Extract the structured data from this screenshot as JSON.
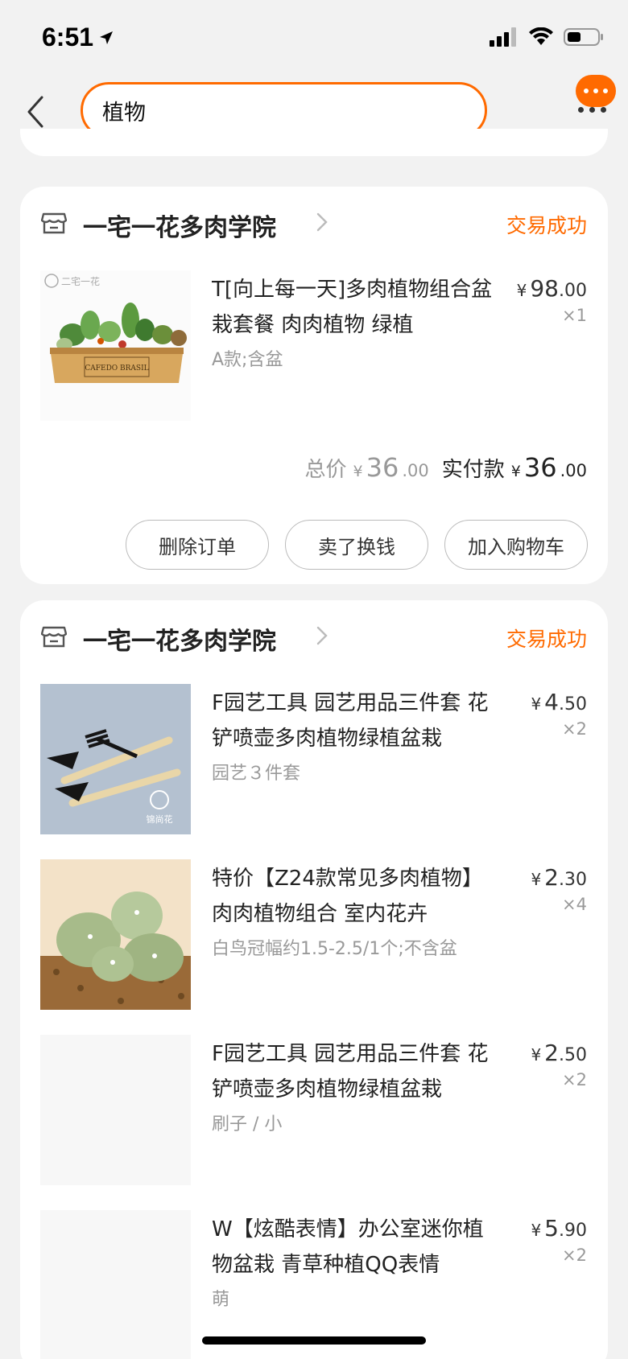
{
  "status_bar": {
    "time": "6:51"
  },
  "header": {
    "search_value": "植物"
  },
  "orders": [
    {
      "shop_name": "一宅一花多肉学院",
      "status": "交易成功",
      "items": [
        {
          "title": "T[向上每一天]多肉植物组合盆栽套餐 肉肉植物 绿植",
          "sku": "A款;含盆",
          "price_int": "98",
          "price_dec": ".00",
          "currency": "¥",
          "qty": "×1"
        }
      ],
      "total_label": "总价",
      "total_int": "36",
      "total_dec": ".00",
      "paid_label": "实付款",
      "paid_int": "36",
      "paid_dec": ".00",
      "buttons": [
        "删除订单",
        "卖了换钱",
        "加入购物车"
      ]
    },
    {
      "shop_name": "一宅一花多肉学院",
      "status": "交易成功",
      "items": [
        {
          "title": "F园艺工具 园艺用品三件套 花铲喷壶多肉植物绿植盆栽",
          "sku": "园艺３件套",
          "price_int": "4",
          "price_dec": ".50",
          "currency": "¥",
          "qty": "×2"
        },
        {
          "title": "特价【Z24款常见多肉植物】肉肉植物组合 室内花卉",
          "sku": "白鸟冠幅约1.5-2.5/1个;不含盆",
          "price_int": "2",
          "price_dec": ".30",
          "currency": "¥",
          "qty": "×4"
        },
        {
          "title": "F园艺工具 园艺用品三件套 花铲喷壶多肉植物绿植盆栽",
          "sku": "刷子 / 小",
          "price_int": "2",
          "price_dec": ".50",
          "currency": "¥",
          "qty": "×2"
        },
        {
          "title": "W【炫酷表情】办公室迷你植物盆栽 青草种植QQ表情",
          "sku": "萌",
          "price_int": "5",
          "price_dec": ".90",
          "currency": "¥",
          "qty": "×2"
        }
      ]
    }
  ],
  "thumb_logos": {
    "item1": "二宅一花",
    "item2": "锦尚花"
  },
  "colors": {
    "accent": "#ff6a00",
    "background": "#f2f2f2",
    "card": "#ffffff"
  }
}
